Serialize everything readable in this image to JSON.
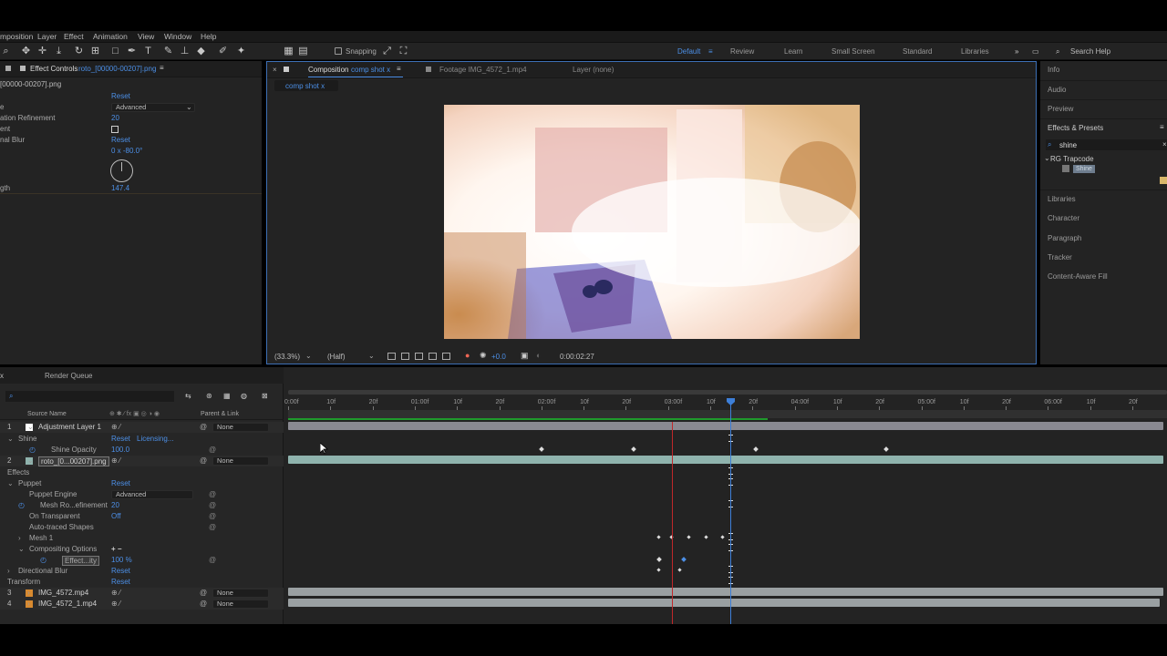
{
  "menu": [
    "mposition",
    "Layer",
    "Effect",
    "Animation",
    "View",
    "Window",
    "Help"
  ],
  "toolbar": {
    "snapping_label": "Snapping"
  },
  "workspaces": {
    "items": [
      "Default",
      "Review",
      "Learn",
      "Small Screen",
      "Standard",
      "Libraries"
    ],
    "search_placeholder": "Search Help"
  },
  "effect_controls": {
    "tab_label": "Effect Controls",
    "tab_file": "roto_[00000-00207].png",
    "subtitle": "[00000-00207].png",
    "rows": [
      {
        "label": "",
        "value": "Reset"
      },
      {
        "label": "e",
        "value": "Advanced"
      },
      {
        "label": "ation Refinement",
        "value": "20"
      },
      {
        "label": "ent",
        "value": ""
      },
      {
        "label": "nal Blur",
        "value": "Reset"
      },
      {
        "label": "",
        "value": "0 x -80.0°"
      },
      {
        "label": "gth",
        "value": "147.4"
      }
    ]
  },
  "composition": {
    "tab_label": "Composition",
    "tab_name": "comp shot x",
    "footage_label": "Footage IMG_4572_1.mp4",
    "layer_label": "Layer (none)",
    "breadcrumb": "comp shot x",
    "zoom": "(33.3%)",
    "resolution": "(Half)",
    "exposure": "+0.0",
    "timecode": "0:00:02:27"
  },
  "right_panel": {
    "items": [
      "Info",
      "Audio",
      "Preview"
    ],
    "effects_presets": "Effects & Presets",
    "search_value": "shine",
    "category": "RG Trapcode",
    "effect": "Shine",
    "more_items": [
      "Libraries",
      "Character",
      "Paragraph",
      "Tracker",
      "Content-Aware Fill"
    ]
  },
  "timeline": {
    "tab_comp": "x",
    "tab_render": "Render Queue",
    "col_source": "Source Name",
    "col_parent": "Parent & Link",
    "ticks": [
      "0:00f",
      "10f",
      "20f",
      "01:00f",
      "10f",
      "20f",
      "02:00f",
      "10f",
      "20f",
      "03:00f",
      "10f",
      "20f",
      "04:00f",
      "10f",
      "20f",
      "05:00f",
      "10f",
      "20f",
      "06:00f",
      "10f",
      "20f"
    ],
    "layers": [
      {
        "num": "1",
        "name": "Adjustment Layer 1",
        "parent": "None"
      },
      {
        "num": "",
        "name": "Shine",
        "parent": ""
      },
      {
        "num": "",
        "name": "Shine Opacity",
        "parent": ""
      },
      {
        "num": "2",
        "name": "roto_[0...00207].png",
        "parent": "None"
      },
      {
        "num": "",
        "name": "Effects",
        "parent": ""
      },
      {
        "num": "",
        "name": "Puppet",
        "parent": ""
      },
      {
        "num": "",
        "name": "Puppet Engine",
        "parent": ""
      },
      {
        "num": "",
        "name": "Mesh Ro...efinement",
        "parent": ""
      },
      {
        "num": "",
        "name": "On Transparent",
        "parent": ""
      },
      {
        "num": "",
        "name": "Auto-traced Shapes",
        "parent": ""
      },
      {
        "num": "",
        "name": "Mesh 1",
        "parent": ""
      },
      {
        "num": "",
        "name": "Compositing Options",
        "parent": ""
      },
      {
        "num": "",
        "name": "Effect...ity",
        "parent": ""
      },
      {
        "num": "",
        "name": "Directional Blur",
        "parent": ""
      },
      {
        "num": "",
        "name": "Transform",
        "parent": ""
      },
      {
        "num": "3",
        "name": "IMG_4572.mp4",
        "parent": "None"
      },
      {
        "num": "4",
        "name": "IMG_4572_1.mp4",
        "parent": "None"
      }
    ],
    "values": {
      "shine_reset": "Reset",
      "shine_licensing": "Licensing...",
      "shine_opacity": "100.0",
      "puppet_reset": "Reset",
      "puppet_engine": "Advanced",
      "mesh_refinement": "20",
      "on_transparent": "Off",
      "effect_opacity": "100 %",
      "dir_blur_reset": "Reset",
      "transform_reset": "Reset"
    }
  },
  "colors": {
    "accent": "#4c8fe6",
    "comp_border": "#3d6fb5",
    "adjustment_bar": "#8a8a92",
    "roto_bar": "#8fb3ad",
    "footage_bar": "#9aa0a2",
    "work_area": "#1f9a2c",
    "playhead": "#3d7fd8",
    "red_marker": "#c0282a"
  }
}
